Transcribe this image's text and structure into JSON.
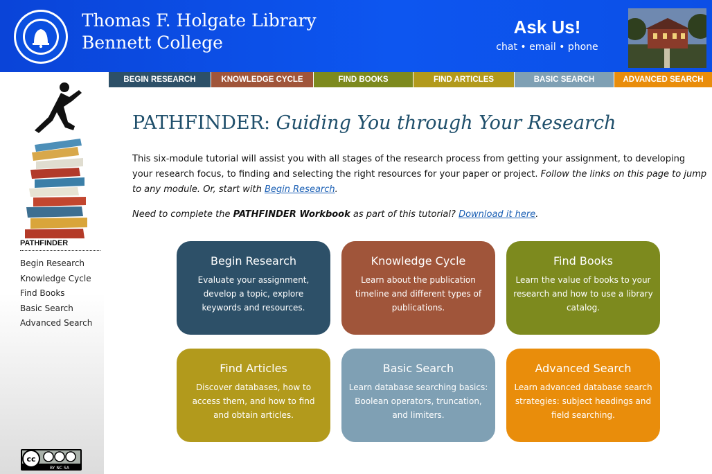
{
  "header": {
    "library_name_line1": "Thomas F. Holgate Library",
    "library_name_line2": "Bennett College",
    "ask_title": "Ask Us!",
    "ask_options": "chat • email • phone",
    "seal_text": "BENNETT COLLEGE • GREENSBORO, NC"
  },
  "nav": {
    "tabs": [
      {
        "label": "BEGIN RESEARCH",
        "color": "#2d5068"
      },
      {
        "label": "KNOWLEDGE CYCLE",
        "color": "#a0553a"
      },
      {
        "label": "FIND BOOKS",
        "color": "#7d8a1e"
      },
      {
        "label": "FIND ARTICLES",
        "color": "#b29a1c"
      },
      {
        "label": "BASIC SEARCH",
        "color": "#7fa0b4"
      },
      {
        "label": "ADVANCED SEARCH",
        "color": "#e98d0b"
      }
    ]
  },
  "sidebar": {
    "heading": "PATHFINDER",
    "items": [
      {
        "label": "Begin Research"
      },
      {
        "label": "Knowledge Cycle"
      },
      {
        "label": "Find Books"
      },
      {
        "label": "Basic Search"
      },
      {
        "label": "Advanced Search"
      }
    ],
    "license_badge": "BY NC SA"
  },
  "main": {
    "title_prefix": "PATHFINDER:",
    "title_italic": "Guiding You through Your Research",
    "intro_text": "This six-module tutorial will assist you with all stages of the research process from getting your assignment, to developing your research focus, to finding and selecting the right resources for your paper or project.",
    "intro_italic": "Follow the links on this page to jump to any module. Or, start with",
    "intro_link": "Begin Research",
    "workbook_pre": "Need to complete the",
    "workbook_bold": "PATHFINDER Workbook",
    "workbook_mid": "as part of this tutorial?",
    "workbook_link": "Download it here"
  },
  "cards": [
    {
      "title": "Begin Research",
      "desc": "Evaluate your assignment, develop a topic, explore keywords and resources.",
      "color": "#2d5068"
    },
    {
      "title": "Knowledge Cycle",
      "desc": "Learn about the publication timeline and different types of publications.",
      "color": "#a0553a"
    },
    {
      "title": "Find Books",
      "desc": "Learn the value of books to your research and how to use a library catalog.",
      "color": "#7d8a1e"
    },
    {
      "title": "Find Articles",
      "desc": "Discover databases, how to access them, and how to find and obtain articles.",
      "color": "#b29a1c"
    },
    {
      "title": "Basic Search",
      "desc": "Learn database searching basics: Boolean operators, truncation, and limiters.",
      "color": "#7fa0b4"
    },
    {
      "title": "Advanced Search",
      "desc": "Learn advanced database search strategies: subject headings and field searching.",
      "color": "#e98d0b"
    }
  ]
}
